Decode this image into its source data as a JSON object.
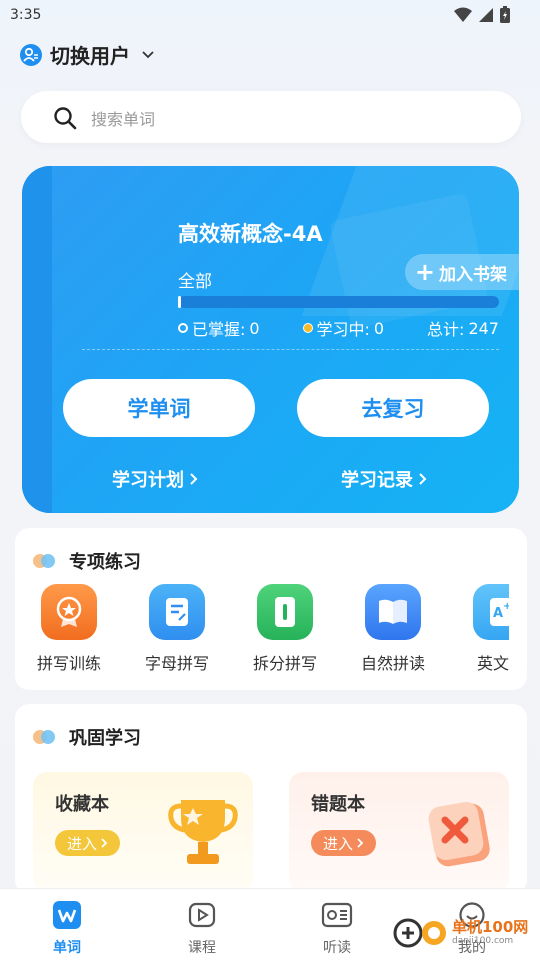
{
  "status": {
    "time": "3:35"
  },
  "header": {
    "user_switch": "切换用户"
  },
  "search": {
    "placeholder": "搜索单词"
  },
  "book": {
    "title": "高效新概念-4A",
    "add_shelf": "加入书架",
    "scope": "全部",
    "progress": 0.01,
    "mastered_label": "已掌握:",
    "mastered": "0",
    "learning_label": "学习中:",
    "learning": "0",
    "total_label": "总计:",
    "total": "247",
    "learn_button": "学单词",
    "review_button": "去复习",
    "plan_link": "学习计划",
    "record_link": "学习记录"
  },
  "special": {
    "title": "专项练习",
    "items": [
      {
        "label": "拼写训练",
        "icon": "spelling-badge-icon",
        "color": "#f5782b"
      },
      {
        "label": "字母拼写",
        "icon": "letter-card-icon",
        "color": "#2f9cf4"
      },
      {
        "label": "拆分拼写",
        "icon": "split-card-icon",
        "color": "#2fbf64"
      },
      {
        "label": "自然拼读",
        "icon": "open-book-icon",
        "color": "#2f86f4"
      },
      {
        "label": "英文选",
        "icon": "english-choice-icon",
        "color": "#3fb1f5"
      }
    ]
  },
  "consolidate": {
    "title": "巩固学习",
    "favorites": {
      "title": "收藏本",
      "enter": "进入"
    },
    "mistakes": {
      "title": "错题本",
      "enter": "进入"
    }
  },
  "nav": {
    "tabs": [
      {
        "label": "单词",
        "active": true
      },
      {
        "label": "课程",
        "active": false
      },
      {
        "label": "听读",
        "active": false
      },
      {
        "label": "我的",
        "active": false
      }
    ]
  },
  "watermark": {
    "text1": "单机100网",
    "text2": "danji100.com"
  }
}
